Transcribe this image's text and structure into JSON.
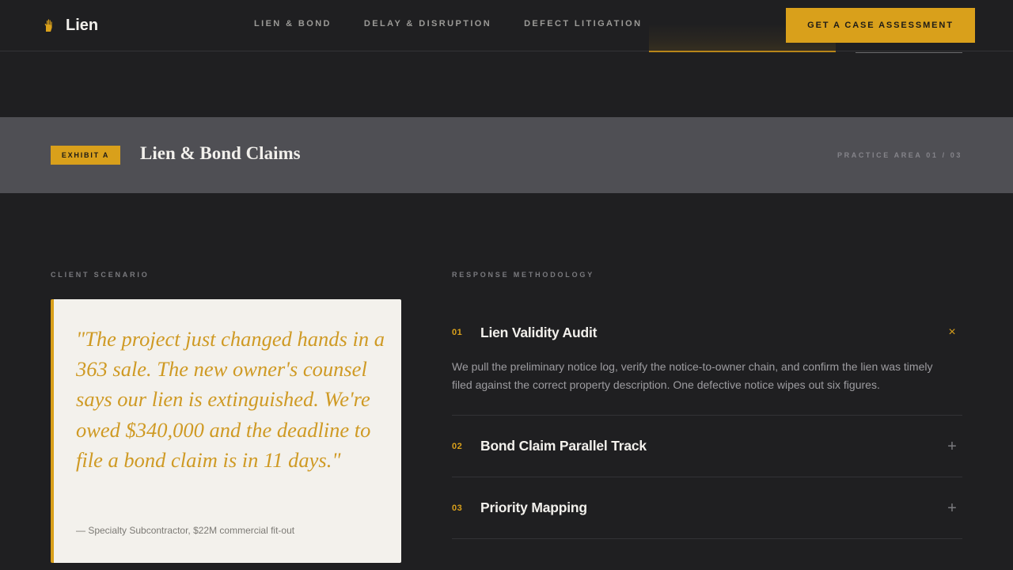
{
  "nav": {
    "brand": "Lien",
    "brand_icon": "hand-icon",
    "links": [
      "LIEN & BOND",
      "DELAY & DISRUPTION",
      "DEFECT LITIGATION"
    ],
    "cta": "GET A CASE ASSESSMENT"
  },
  "exhibit": {
    "tag": "EXHIBIT A",
    "title": "Lien & Bond Claims",
    "meta": "PRACTICE AREA 01 / 03"
  },
  "scenario": {
    "label": "CLIENT SCENARIO",
    "quote": "\"The project just changed hands in a 363 sale. The new owner's counsel says our lien is extinguished. We're owed $340,000 and the deadline to file a bond claim is in 11 days.\"",
    "cite": "— Specialty Subcontractor, $22M commercial fit-out"
  },
  "methodology": {
    "label": "RESPONSE METHODOLOGY",
    "items": [
      {
        "num": "01",
        "title": "Lien Validity Audit",
        "body": "We pull the preliminary notice log, verify the notice-to-owner chain, and confirm the lien was timely filed against the correct property description. One defective notice wipes out six figures.",
        "toggle": "×",
        "expanded": true
      },
      {
        "num": "02",
        "title": "Bond Claim Parallel Track",
        "toggle": "+",
        "expanded": false
      },
      {
        "num": "03",
        "title": "Priority Mapping",
        "toggle": "+",
        "expanded": false
      }
    ]
  },
  "colors": {
    "accent": "#d9a01b",
    "background": "#1f1f21",
    "band": "#4f4f54",
    "card": "#f3f1ec"
  }
}
